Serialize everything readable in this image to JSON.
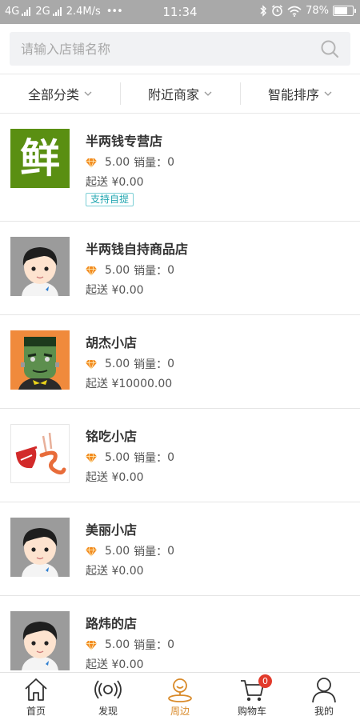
{
  "status_bar": {
    "net1": "4G",
    "net2": "2G",
    "speed": "2.4M/s",
    "more": "•••",
    "time": "11:34",
    "battery_text": "78%",
    "battery_level": 0.78
  },
  "search": {
    "placeholder": "请输入店铺名称"
  },
  "filters": [
    {
      "label": "全部分类"
    },
    {
      "label": "附近商家"
    },
    {
      "label": "智能排序"
    }
  ],
  "shops": [
    {
      "name": "半两钱专营店",
      "rating": "5.00",
      "sales_label": "销量：",
      "sales": "0",
      "min_label": "起送",
      "min_price": "¥0.00",
      "tag": "支持自提",
      "logo_char": "鲜",
      "image": "fresh-logo"
    },
    {
      "name": "半两钱自持商品店",
      "rating": "5.00",
      "sales_label": "销量：",
      "sales": "0",
      "min_label": "起送",
      "min_price": "¥0.00",
      "image": "default-avatar"
    },
    {
      "name": "胡杰小店",
      "rating": "5.00",
      "sales_label": "销量：",
      "sales": "0",
      "min_label": "起送",
      "min_price": "¥10000.00",
      "image": "frankenstein-avatar"
    },
    {
      "name": "铭吃小店",
      "rating": "5.00",
      "sales_label": "销量：",
      "sales": "0",
      "min_label": "起送",
      "min_price": "¥0.00",
      "image": "chi-logo"
    },
    {
      "name": "美丽小店",
      "rating": "5.00",
      "sales_label": "销量：",
      "sales": "0",
      "min_label": "起送",
      "min_price": "¥0.00",
      "image": "default-avatar"
    },
    {
      "name": "路炜的店",
      "rating": "5.00",
      "sales_label": "销量：",
      "sales": "0",
      "min_label": "起送",
      "min_price": "¥0.00",
      "image": "default-avatar"
    }
  ],
  "tabbar": [
    {
      "label": "首页",
      "icon": "home-icon"
    },
    {
      "label": "发现",
      "icon": "broadcast-icon"
    },
    {
      "label": "周边",
      "icon": "nearby-icon",
      "active": true
    },
    {
      "label": "购物车",
      "icon": "cart-icon",
      "badge": "0"
    },
    {
      "label": "我的",
      "icon": "user-icon"
    }
  ],
  "colors": {
    "accent": "#d98b2b",
    "tag": "#21a6b0",
    "badge": "#e23a2b",
    "fresh_logo_bg": "#5a8f12"
  }
}
